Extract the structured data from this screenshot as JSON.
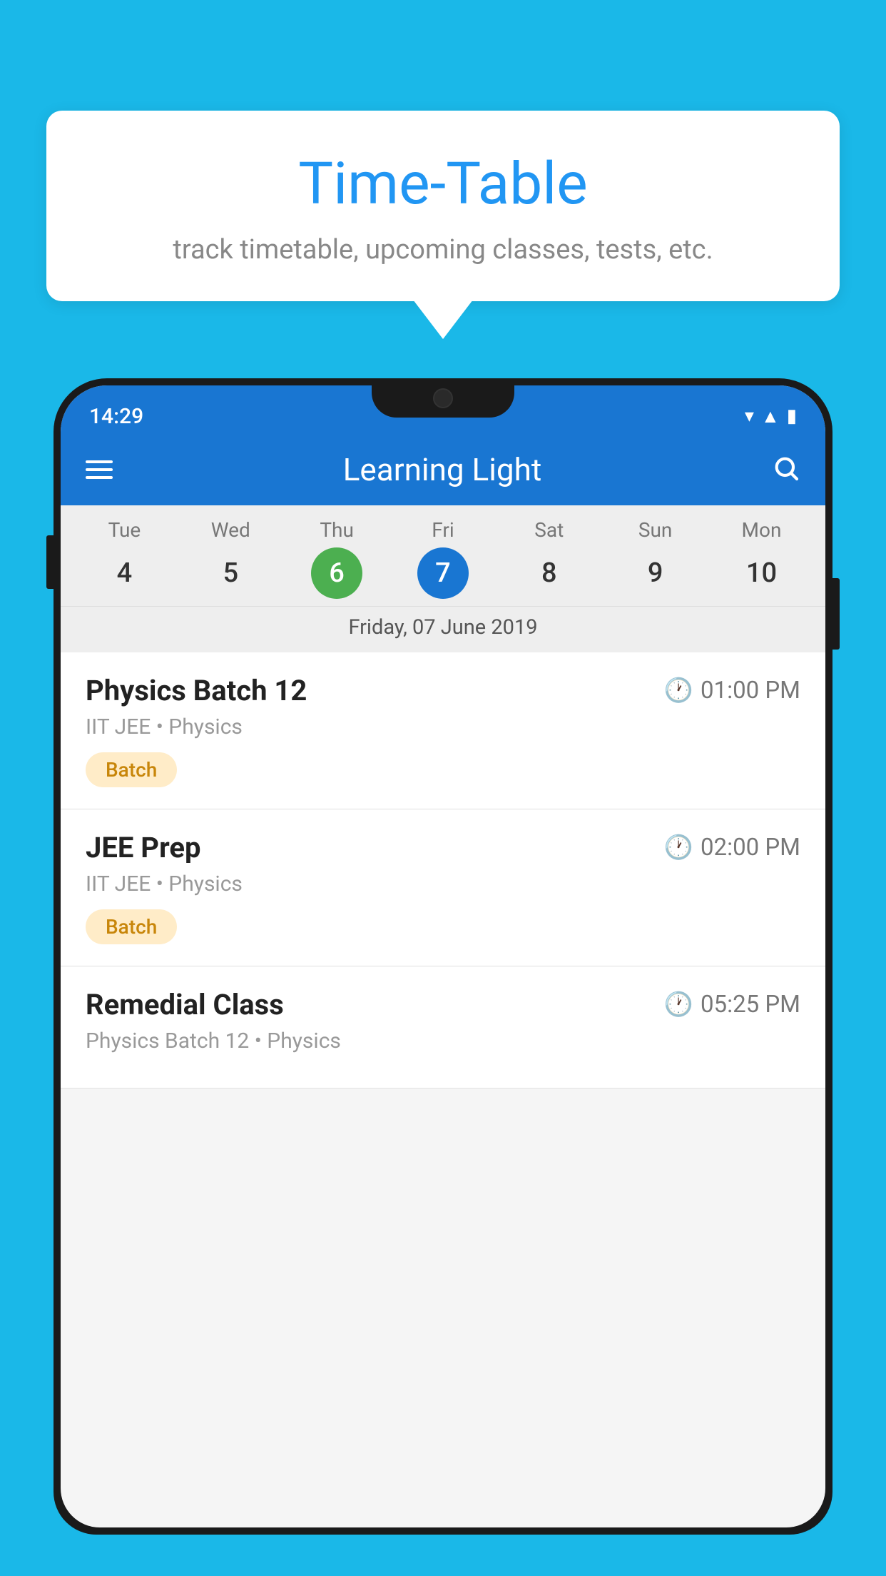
{
  "background_color": "#1ab8e8",
  "speech_bubble": {
    "title": "Time-Table",
    "subtitle": "track timetable, upcoming classes, tests, etc."
  },
  "status_bar": {
    "time": "14:29"
  },
  "app_bar": {
    "title": "Learning Light"
  },
  "calendar": {
    "selected_date_label": "Friday, 07 June 2019",
    "days": [
      {
        "name": "Tue",
        "number": "4",
        "state": "normal"
      },
      {
        "name": "Wed",
        "number": "5",
        "state": "normal"
      },
      {
        "name": "Thu",
        "number": "6",
        "state": "today"
      },
      {
        "name": "Fri",
        "number": "7",
        "state": "selected"
      },
      {
        "name": "Sat",
        "number": "8",
        "state": "normal"
      },
      {
        "name": "Sun",
        "number": "9",
        "state": "normal"
      },
      {
        "name": "Mon",
        "number": "10",
        "state": "normal"
      }
    ]
  },
  "schedule": {
    "items": [
      {
        "title": "Physics Batch 12",
        "time": "01:00 PM",
        "subtitle": "IIT JEE • Physics",
        "badge": "Batch"
      },
      {
        "title": "JEE Prep",
        "time": "02:00 PM",
        "subtitle": "IIT JEE • Physics",
        "badge": "Batch"
      },
      {
        "title": "Remedial Class",
        "time": "05:25 PM",
        "subtitle": "Physics Batch 12 • Physics",
        "badge": ""
      }
    ]
  }
}
